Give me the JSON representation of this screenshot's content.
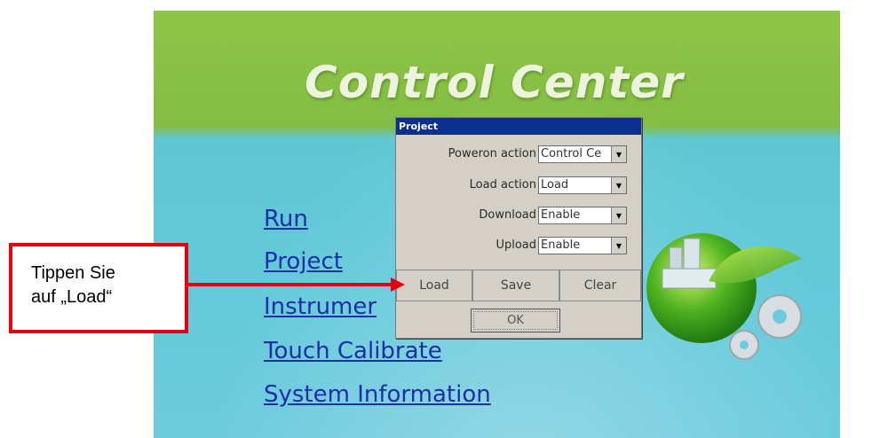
{
  "screen": {
    "title": "Control Center",
    "menu": [
      {
        "label": "Run"
      },
      {
        "label": "Project"
      },
      {
        "label": "Instrumer"
      },
      {
        "label": "Touch Calibrate"
      },
      {
        "label": "System Information"
      }
    ]
  },
  "dialog": {
    "title": "Project",
    "fields": [
      {
        "label": "Poweron action",
        "value": "Control Ce"
      },
      {
        "label": "Load action",
        "value": "Load"
      },
      {
        "label": "Download",
        "value": "Enable"
      },
      {
        "label": "Upload",
        "value": "Enable"
      }
    ],
    "buttons": {
      "load": "Load",
      "save": "Save",
      "clear": "Clear",
      "ok": "OK"
    }
  },
  "callout": {
    "text": "Tippen Sie\nauf „Load“",
    "border_color": "#e3000f"
  },
  "colors": {
    "screen_green": "#84bd44",
    "screen_cyan": "#62c9d9",
    "titlebar": "#0a2f8f",
    "link": "#1d2fa8"
  }
}
